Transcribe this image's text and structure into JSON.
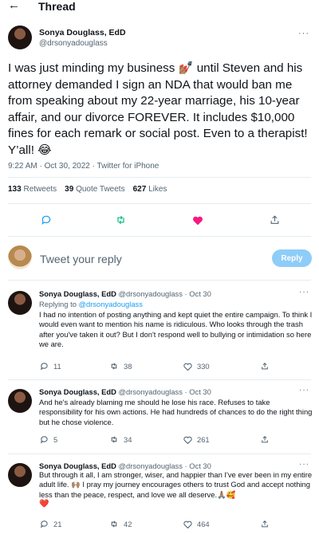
{
  "header": {
    "back_icon": "back-arrow-icon",
    "title": "Thread"
  },
  "main_tweet": {
    "author_name": "Sonya Douglass, EdD",
    "author_handle": "@drsonyadouglass",
    "more_label": "···",
    "text_part1": "I was just minding my business ",
    "inline_emoji": "💅🏽",
    "text_part2": " until Steven and his attorney demanded I sign an NDA that would ban me from speaking about my 22-year marriage, his 10-year affair, and our divorce FOREVER. It includes $10,000 fines for each remark or social post. Even to a therapist! Y’all! ",
    "end_emoji": "😂",
    "timestamp": "9:22 AM · Oct 30, 2022 · Twitter for iPhone",
    "retweets_count": "133",
    "retweets_label": "Retweets",
    "quotes_count": "39",
    "quotes_label": "Quote Tweets",
    "likes_count": "627",
    "likes_label": "Likes"
  },
  "reply_box": {
    "placeholder": "Tweet your reply",
    "button_label": "Reply"
  },
  "replies": [
    {
      "name": "Sonya Douglass, EdD",
      "handle": "@drsonyadouglass · Oct 30",
      "replying_prefix": "Replying to ",
      "replying_handle": "@drsonyadouglass",
      "text": "I had no intention of posting anything and kept quiet the entire campaign. To think I would even want to mention his name is ridiculous. Who looks through the trash after you've taken it out? But I don't respond well to bullying or intimidation so here we are.",
      "replies": "11",
      "retweets": "38",
      "likes": "330"
    },
    {
      "name": "Sonya Douglass, EdD",
      "handle": "@drsonyadouglass · Oct 30",
      "text": "And he's already blaming me should he lose his race. Refuses to take responsibility for his own actions. He had hundreds of chances to do the right thing but he chose violence.",
      "replies": "5",
      "retweets": "34",
      "likes": "261"
    },
    {
      "name": "Sonya Douglass, EdD",
      "handle": "@drsonyadouglass · Oct 30",
      "text": "But through it all, I am stronger, wiser, and happier than I've ever been in my entire adult life. 🙌🏽 I pray my journey encourages others to trust God and accept nothing less than the peace, respect, and love we all deserve.🙏🏽🥰",
      "heart_emoji": "❤️",
      "replies": "21",
      "retweets": "42",
      "likes": "464"
    }
  ],
  "colors": {
    "accent": "#1d9bf0",
    "like_pink": "#f91880",
    "retweet_green": "#00ba7c",
    "muted": "#536471"
  }
}
